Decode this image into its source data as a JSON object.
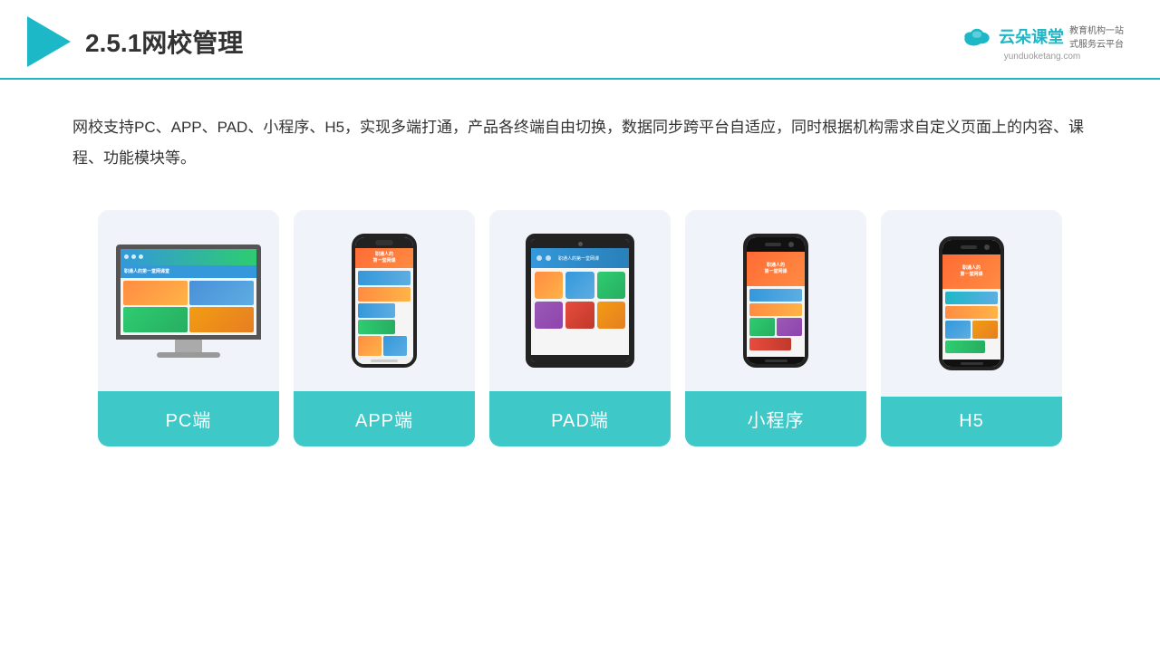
{
  "header": {
    "title": "2.5.1网校管理",
    "brand": {
      "name": "云朵课堂",
      "url": "yunduoketang.com",
      "tagline": "教育机构一站\n式服务云平台"
    }
  },
  "description": "网校支持PC、APP、PAD、小程序、H5，实现多端打通，产品各终端自由切换，数据同步跨平台自适应，同时根据机构需求自定义页面上的内容、课程、功能模块等。",
  "cards": [
    {
      "id": "pc",
      "label": "PC端"
    },
    {
      "id": "app",
      "label": "APP端"
    },
    {
      "id": "pad",
      "label": "PAD端"
    },
    {
      "id": "miniapp",
      "label": "小程序"
    },
    {
      "id": "h5",
      "label": "H5"
    }
  ],
  "colors": {
    "accent": "#1db8c8",
    "card_bg": "#eef2f8",
    "card_label_bg": "#3ec8c8",
    "header_border": "#1db8c8"
  }
}
